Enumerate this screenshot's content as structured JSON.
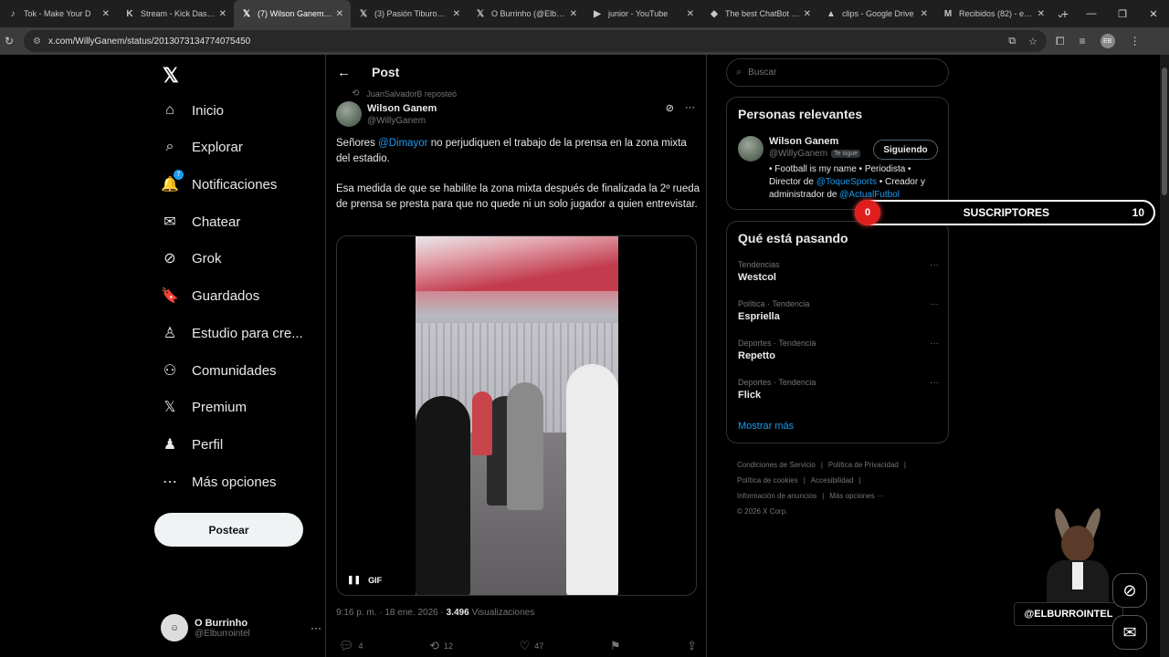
{
  "browser": {
    "tabs": [
      {
        "title": "Tok - Make Your D",
        "icon": "tiktok-icon",
        "fav": "♪"
      },
      {
        "title": "Stream - Kick Dashbo",
        "icon": "kick-icon",
        "fav": "K"
      },
      {
        "title": "(7) Wilson Ganem en",
        "icon": "x-icon",
        "fav": "𝕏",
        "active": true
      },
      {
        "title": "(3) Pasión Tiburona e",
        "icon": "x-icon",
        "fav": "𝕏"
      },
      {
        "title": "O Burrinho (@Elburri",
        "icon": "x-icon",
        "fav": "𝕏"
      },
      {
        "title": "junior - YouTube",
        "icon": "youtube-icon",
        "fav": "▶"
      },
      {
        "title": "The best ChatBot an",
        "icon": "chatbot-icon",
        "fav": "◆"
      },
      {
        "title": "clips - Google Drive",
        "icon": "drive-icon",
        "fav": "▲"
      },
      {
        "title": "Recibidos (82) - elbur",
        "icon": "gmail-icon",
        "fav": "M"
      }
    ],
    "url": "x.com/WillyGanem/status/2013073134774075450",
    "profile_initials": "EB"
  },
  "nav": {
    "logo": "𝕏",
    "items": [
      {
        "label": "Inicio",
        "icon": "home-icon",
        "glyph": "⌂"
      },
      {
        "label": "Explorar",
        "icon": "search-icon",
        "glyph": "⌕"
      },
      {
        "label": "Notificaciones",
        "icon": "bell-icon",
        "glyph": "🔔",
        "badge": "7"
      },
      {
        "label": "Chatear",
        "icon": "mail-icon",
        "glyph": "✉"
      },
      {
        "label": "Grok",
        "icon": "grok-icon",
        "glyph": "⊘"
      },
      {
        "label": "Guardados",
        "icon": "bookmark-icon",
        "glyph": "🔖"
      },
      {
        "label": "Estudio para cre...",
        "icon": "creator-studio-icon",
        "glyph": "♙"
      },
      {
        "label": "Comunidades",
        "icon": "communities-icon",
        "glyph": "⚇"
      },
      {
        "label": "Premium",
        "icon": "x-premium-icon",
        "glyph": "𝕏"
      },
      {
        "label": "Perfil",
        "icon": "profile-icon",
        "glyph": "♟"
      },
      {
        "label": "Más opciones",
        "icon": "more-options-icon",
        "glyph": "⋯"
      }
    ],
    "post_button": "Postear",
    "me": {
      "name": "O Burrinho",
      "handle": "@Elburrointel"
    }
  },
  "post": {
    "header_title": "Post",
    "reposted_by": "JuanSalvadorB reposteó",
    "author_name": "Wilson Ganem",
    "author_handle": "@WillyGanem",
    "text_1_pre": "Señores ",
    "text_1_mention": "@Dimayor",
    "text_1_post": " no perjudiquen el trabajo de la prensa en la zona mixta del estadio.",
    "text_2": "Esa medida de que se habilite la zona mixta después de finalizada la 2º rueda de prensa se presta para que no quede ni un solo jugador a quien entrevistar.",
    "media_label": "GIF",
    "time": "9:16 p. m. · 18 ene. 2026 · ",
    "views_count": "3.496",
    "views_label": " Visualizaciones",
    "replies": "4",
    "reposts": "12",
    "likes": "47"
  },
  "right": {
    "search_placeholder": "Buscar",
    "relevant_title": "Personas relevantes",
    "person": {
      "name": "Wilson Ganem",
      "handle": "@WillyGanem",
      "follows_you": "Te sigue",
      "button": "Siguiendo",
      "bio_1": "• Football is my name • Periodista • Director de ",
      "bio_mention_1": "@ToqueSports",
      "bio_2": " • Creador y administrador de ",
      "bio_mention_2": "@ActualFutbol"
    },
    "trending_title": "Qué está pasando",
    "trends": [
      {
        "category": "Tendencias",
        "name": "Westcol"
      },
      {
        "category": "Política · Tendencia",
        "name": "Espriella"
      },
      {
        "category": "Deportes · Tendencia",
        "name": "Repetto"
      },
      {
        "category": "Deportes · Tendencia",
        "name": "Flick"
      }
    ],
    "show_more": "Mostrar más",
    "footer": [
      "Condiciones de Servicio",
      "|",
      "Política de Privacidad",
      "|",
      "Política de cookies",
      "|",
      "Accesibilidad",
      "|",
      "Información de anuncios",
      "|",
      "Más opciones ···",
      "© 2026 X Corp."
    ]
  },
  "overlay": {
    "subs_count": "0",
    "subs_label": "SUSCRIPTORES",
    "subs_goal": "10",
    "handle_tag": "@ELBURROINTEL"
  },
  "colors": {
    "accent": "#1d9bf0",
    "background": "#000000",
    "sub_red": "#e01e1e"
  }
}
